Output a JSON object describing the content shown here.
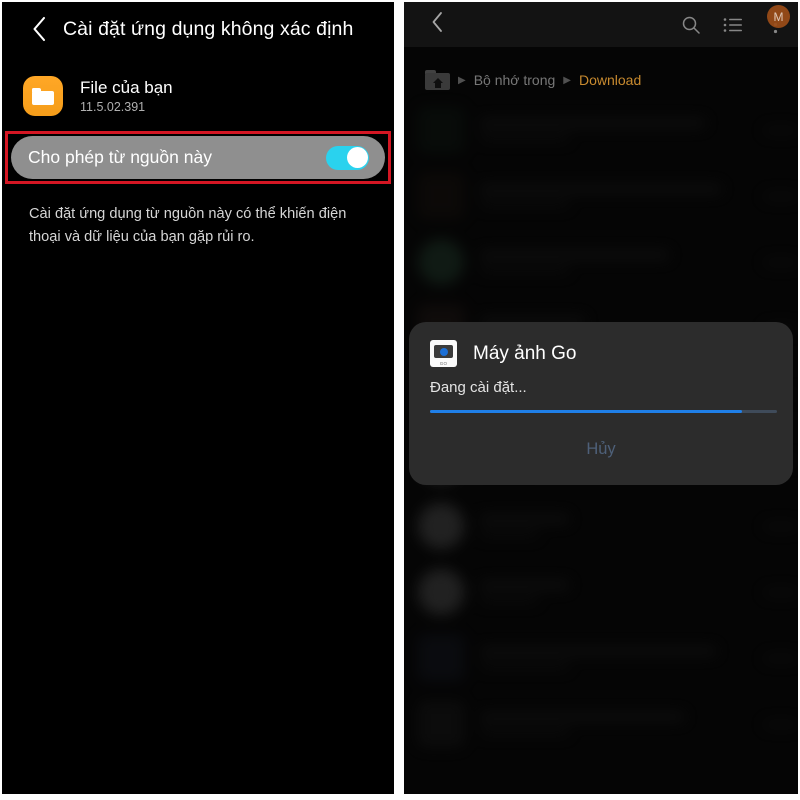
{
  "left_panel": {
    "header": {
      "back_icon": "chevron-left-icon",
      "title": "Cài đặt ứng dụng không xác định"
    },
    "app": {
      "icon": "folder-icon",
      "name": "File của bạn",
      "version": "11.5.02.391"
    },
    "toggle_setting": {
      "label": "Cho phép từ nguồn này",
      "state": "on",
      "highlight_color": "#d41623",
      "switch_color": "#2ad2ee",
      "row_background": "#8f8f8f"
    },
    "description": "Cài đặt ứng dụng từ nguồn này có thể khiến điện thoại và dữ liệu của bạn gặp rủi ro."
  },
  "right_panel": {
    "topbar": {
      "back_icon": "chevron-left-icon",
      "search_icon": "search-icon",
      "list_view_icon": "list-view-icon",
      "overflow_icon": "more-vertical-icon",
      "avatar_initial": "M",
      "avatar_color": "#9c4d18"
    },
    "breadcrumb": {
      "home_icon": "home-folder-icon",
      "separator": "▶",
      "items": [
        {
          "label": "Bộ nhớ trong",
          "active": false
        },
        {
          "label": "Download",
          "active": true
        }
      ],
      "active_color": "#c98b2f"
    },
    "background_list": {
      "rows": [
        {
          "thumb_color": "#1a2a1f"
        },
        {
          "thumb_color": "#2a1f18"
        },
        {
          "thumb_color": "#3e6b50"
        },
        {
          "thumb_color": "#3a2a24"
        },
        {
          "thumb_color": "#4a3028"
        },
        {
          "thumb_color": "#8a8a8a"
        },
        {
          "thumb_color": "#8a8a8a"
        },
        {
          "thumb_color": "#8a8a8a"
        },
        {
          "thumb_color": "#23283a"
        },
        {
          "thumb_color": "#2a2a2a"
        }
      ]
    },
    "install_dialog": {
      "app_icon": "camera-go-icon",
      "app_name": "Máy ảnh Go",
      "status_text": "Đang cài đặt...",
      "progress_percent": 90,
      "progress_color": "#1f7fe8",
      "progress_track_color": "#3f4b5a",
      "cancel_label": "Hủy",
      "cancel_color": "#4e6079"
    }
  }
}
